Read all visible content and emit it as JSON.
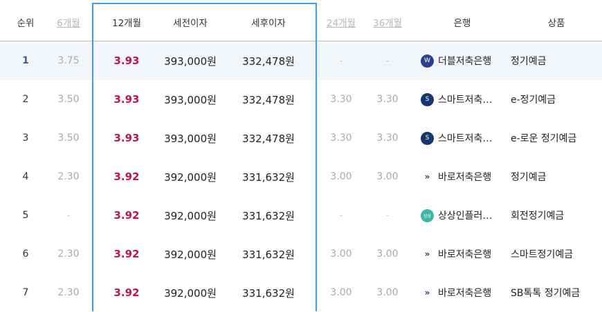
{
  "header": {
    "rank": "순위",
    "m6": "6개월",
    "m12": "12개월",
    "pre_interest": "세전이자",
    "post_interest": "세후이자",
    "m24": "24개월",
    "m36": "36개월",
    "bank": "은행",
    "product": "상품"
  },
  "rows": [
    {
      "rank": "1",
      "m6": "3.75",
      "m12": "3.93",
      "pre": "393,000원",
      "post": "332,478원",
      "m24": "-",
      "m36": "-",
      "bank": "더블저축은행",
      "bank_icon": "double-bank-logo",
      "product": "정기예금"
    },
    {
      "rank": "2",
      "m6": "3.50",
      "m12": "3.93",
      "pre": "393,000원",
      "post": "332,478원",
      "m24": "3.30",
      "m36": "3.30",
      "bank": "스마트저축…",
      "bank_icon": "smart-bank-logo",
      "product": "e-정기예금"
    },
    {
      "rank": "3",
      "m6": "3.50",
      "m12": "3.93",
      "pre": "393,000원",
      "post": "332,478원",
      "m24": "3.30",
      "m36": "3.30",
      "bank": "스마트저축…",
      "bank_icon": "smart-bank-logo",
      "product": "e-로운 정기예금"
    },
    {
      "rank": "4",
      "m6": "2.30",
      "m12": "3.92",
      "pre": "392,000원",
      "post": "331,632원",
      "m24": "3.00",
      "m36": "3.00",
      "bank": "바로저축은행",
      "bank_icon": "baro-bank-logo",
      "product": "정기예금"
    },
    {
      "rank": "5",
      "m6": "-",
      "m12": "3.92",
      "pre": "392,000원",
      "post": "331,632원",
      "m24": "-",
      "m36": "-",
      "bank": "상상인플러…",
      "bank_icon": "sangsangin-bank-logo",
      "product": "회전정기예금"
    },
    {
      "rank": "6",
      "m6": "2.30",
      "m12": "3.92",
      "pre": "392,000원",
      "post": "331,632원",
      "m24": "3.00",
      "m36": "3.00",
      "bank": "바로저축은행",
      "bank_icon": "baro-bank-logo",
      "product": "스마트정기예금"
    },
    {
      "rank": "7",
      "m6": "2.30",
      "m12": "3.92",
      "pre": "392,000원",
      "post": "331,632원",
      "m24": "3.00",
      "m36": "3.00",
      "bank": "바로저축은행",
      "bank_icon": "baro-bank-logo",
      "product": "SB톡톡 정기예금"
    }
  ],
  "colors": {
    "rate": "#c4134e",
    "highlight_border": "#3aa0ea",
    "rank1": "#3a5f91",
    "row1_bg": "#f2f6fb"
  }
}
